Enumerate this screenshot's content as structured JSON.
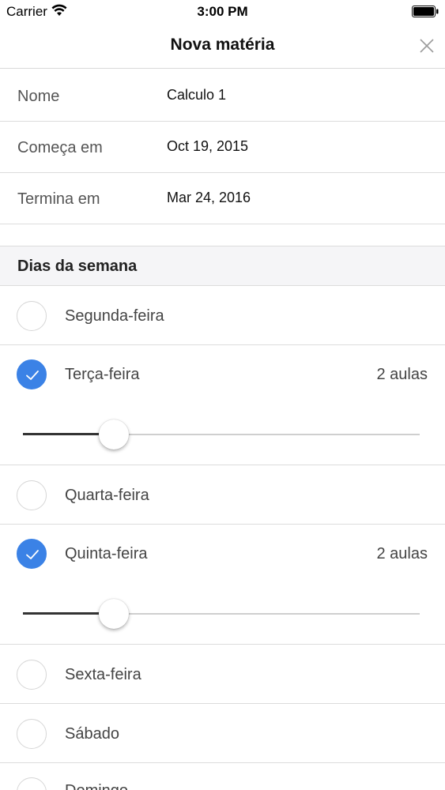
{
  "status_bar": {
    "carrier": "Carrier",
    "time": "3:00 PM"
  },
  "nav": {
    "title": "Nova matéria",
    "close_icon": "close-icon"
  },
  "form": {
    "name_label": "Nome",
    "name_value": "Calculo 1",
    "start_label": "Começa em",
    "start_value": "Oct 19, 2015",
    "end_label": "Termina em",
    "end_value": "Mar 24, 2016"
  },
  "section": {
    "title": "Dias da semana"
  },
  "days": [
    {
      "label": "Segunda-feira",
      "checked": false
    },
    {
      "label": "Terça-feira",
      "checked": true,
      "count": "2 aulas",
      "slider_fraction": 0.23
    },
    {
      "label": "Quarta-feira",
      "checked": false
    },
    {
      "label": "Quinta-feira",
      "checked": true,
      "count": "2 aulas",
      "slider_fraction": 0.23
    },
    {
      "label": "Sexta-feira",
      "checked": false
    },
    {
      "label": "Sábado",
      "checked": false
    },
    {
      "label": "Domingo",
      "checked": false
    }
  ],
  "colors": {
    "accent": "#3b82e6"
  }
}
